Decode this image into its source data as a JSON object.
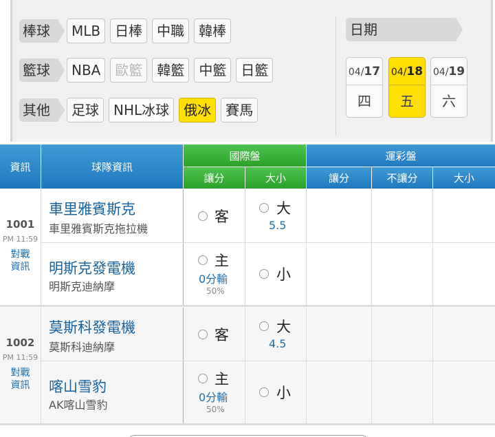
{
  "filters": {
    "rows": [
      {
        "category": "棒球",
        "chips": [
          "MLB",
          "日棒",
          "中職",
          "韓棒"
        ]
      },
      {
        "category": "籃球",
        "chips": [
          "NBA",
          "歐籃",
          "韓籃",
          "中籃",
          "日籃"
        ]
      },
      {
        "category": "其他",
        "chips": [
          "足球",
          "NHL冰球",
          "俄冰",
          "賽馬"
        ]
      }
    ],
    "active_chip": "俄冰",
    "disabled_chip": "歐籃"
  },
  "dates": {
    "label": "日期",
    "items": [
      {
        "month": "04/",
        "day": "17",
        "weekday": "四",
        "active": false
      },
      {
        "month": "04/",
        "day": "18",
        "weekday": "五",
        "active": true
      },
      {
        "month": "04/",
        "day": "19",
        "weekday": "六",
        "active": false
      }
    ]
  },
  "table": {
    "col_info": "資訊",
    "col_team": "球隊資訊",
    "intl": {
      "title": "國際盤",
      "handicap": "讓分",
      "total": "大小"
    },
    "sport": {
      "title": "運彩盤",
      "handicap": "讓分",
      "no_handicap": "不讓分",
      "total": "大小"
    }
  },
  "games": [
    {
      "number": "1001",
      "time": "PM 11:59",
      "link": [
        "對戰",
        "資訊"
      ],
      "away": {
        "name": "車里雅賓斯克",
        "sub": "車里雅賓斯克拖拉機",
        "side": "客",
        "total_side": "大",
        "total": "5.5"
      },
      "home": {
        "name": "明斯克發電機",
        "sub": "明斯克迪納摩",
        "side": "主",
        "handicap": "0分輸",
        "pct": "50%",
        "total_side": "小"
      }
    },
    {
      "number": "1002",
      "time": "PM 11:59",
      "link": [
        "對戰",
        "資訊"
      ],
      "away": {
        "name": "莫斯科發電機",
        "sub": "莫斯科迪納摩",
        "side": "客",
        "total_side": "大",
        "total": "4.5"
      },
      "home": {
        "name": "喀山雪豹",
        "sub": "AK喀山雪豹",
        "side": "主",
        "handicap": "0分輸",
        "pct": "50%",
        "total_side": "小"
      }
    }
  ],
  "colors": {
    "accent_yellow": "#ffe000",
    "header_blue": "#2a86c8",
    "header_green": "#3bb33b",
    "team_blue": "#17639f"
  }
}
